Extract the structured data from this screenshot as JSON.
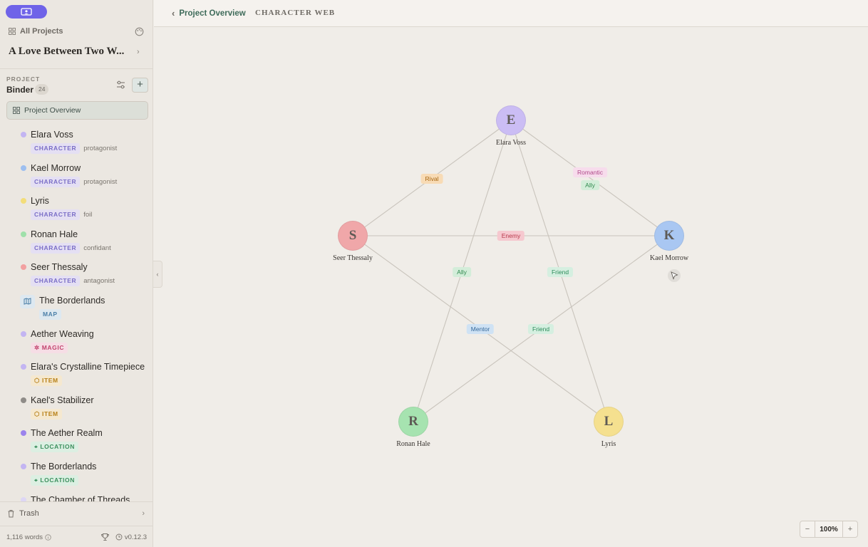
{
  "sidebar": {
    "all_projects_label": "All Projects",
    "project_title": "A Love Between Two W...",
    "section_label": "PROJECT",
    "binder_label": "Binder",
    "binder_count": "24",
    "overview_label": "Project Overview",
    "items": [
      {
        "name": "Elara Voss",
        "tag": "CHARACTER",
        "role": "protagonist",
        "dot": "#c3b5f2"
      },
      {
        "name": "Kael Morrow",
        "tag": "CHARACTER",
        "role": "protagonist",
        "dot": "#9dbff0"
      },
      {
        "name": "Lyris",
        "tag": "CHARACTER",
        "role": "foil",
        "dot": "#f3dd79"
      },
      {
        "name": "Ronan Hale",
        "tag": "CHARACTER",
        "role": "confidant",
        "dot": "#9fe0aa"
      },
      {
        "name": "Seer Thessaly",
        "tag": "CHARACTER",
        "role": "antagonist",
        "dot": "#f2a0a0"
      },
      {
        "name": "The Borderlands",
        "tag": "MAP"
      },
      {
        "name": "Aether Weaving",
        "tag": "MAGIC",
        "dot": "#c3b5f2"
      },
      {
        "name": "Elara's Crystalline Timepiece",
        "tag": "ITEM",
        "dot": "#c3b5f2"
      },
      {
        "name": "Kael's Stabilizer",
        "tag": "ITEM",
        "dot": "#8f8c88"
      },
      {
        "name": "The Aether Realm",
        "tag": "LOCATION",
        "dot": "#9b83ec"
      },
      {
        "name": "The Borderlands",
        "tag": "LOCATION",
        "dot": "#c3b5f2"
      },
      {
        "name": "The Chamber of Threads",
        "tag": "",
        "dot": "#ddd6f5"
      }
    ],
    "trash_label": "Trash",
    "word_count": "1,116 words",
    "version": "v0.12.3"
  },
  "topbar": {
    "back_label": "Project Overview",
    "current_label": "CHARACTER WEB"
  },
  "graph": {
    "nodes": [
      {
        "letter": "E",
        "name": "Elara Voss",
        "color": "#cbbdf4"
      },
      {
        "letter": "K",
        "name": "Kael Morrow",
        "color": "#a9c7f2"
      },
      {
        "letter": "S",
        "name": "Seer Thessaly",
        "color": "#f0a7a9"
      },
      {
        "letter": "R",
        "name": "Ronan Hale",
        "color": "#a6e3b0"
      },
      {
        "letter": "L",
        "name": "Lyris",
        "color": "#f5e08f"
      }
    ],
    "edges": [
      {
        "from": "E",
        "to": "S",
        "label": "Rival",
        "style": "rival"
      },
      {
        "from": "E",
        "to": "K",
        "label": "Romantic",
        "style": "romantic"
      },
      {
        "from": "E",
        "to": "K",
        "label": "Ally",
        "style": "ally"
      },
      {
        "from": "S",
        "to": "K",
        "label": "Enemy",
        "style": "enemy"
      },
      {
        "from": "E",
        "to": "R",
        "label": "Ally",
        "style": "ally"
      },
      {
        "from": "E",
        "to": "L",
        "label": "Friend",
        "style": "friend"
      },
      {
        "from": "S",
        "to": "L",
        "label": "Mentor",
        "style": "mentor"
      },
      {
        "from": "K",
        "to": "R",
        "label": "Friend",
        "style": "friend"
      }
    ]
  },
  "zoom": {
    "minus": "−",
    "value": "100%",
    "plus": "+"
  }
}
